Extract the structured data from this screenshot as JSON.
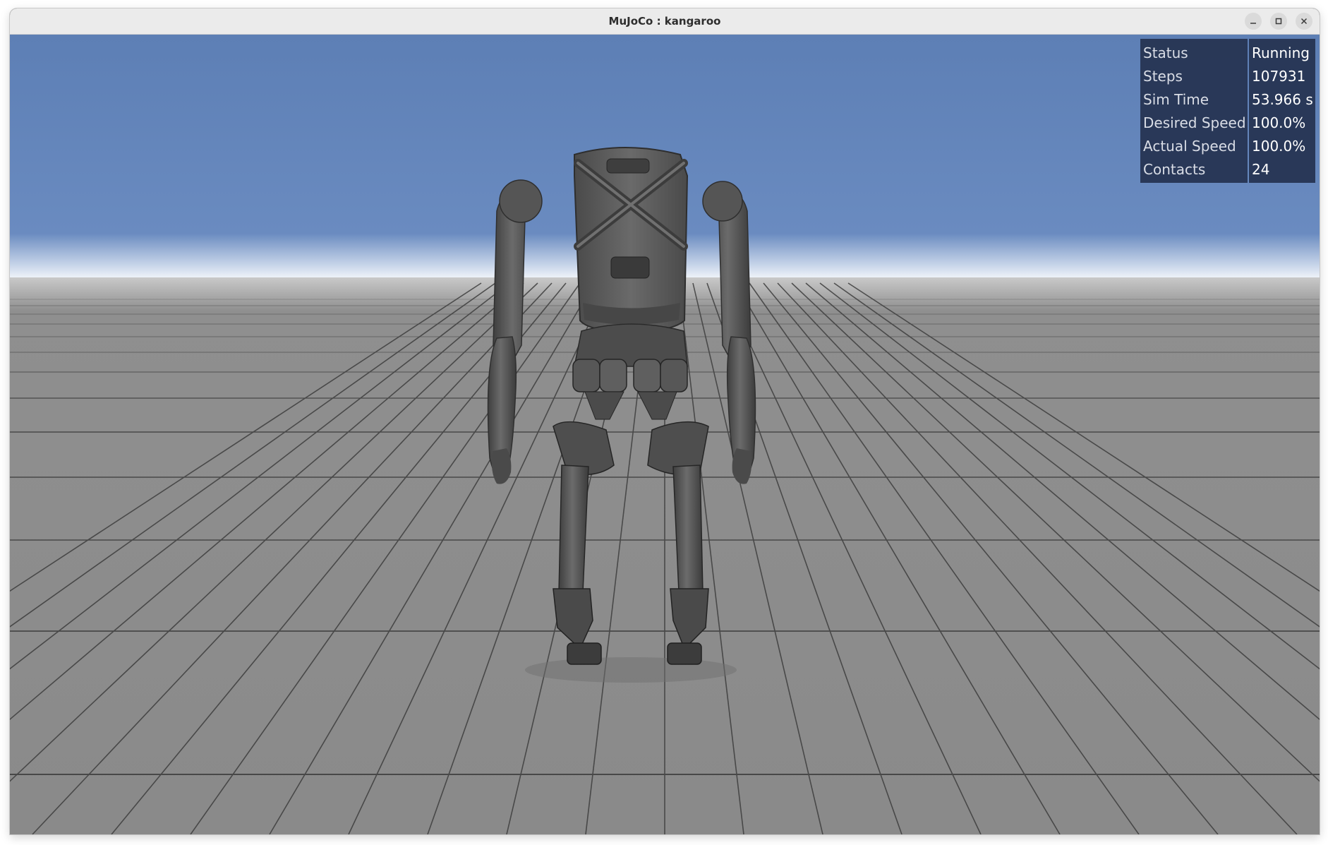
{
  "window": {
    "title": "MuJoCo : kangaroo",
    "controls": [
      {
        "name": "minimize-icon"
      },
      {
        "name": "maximize-icon"
      },
      {
        "name": "close-icon"
      }
    ]
  },
  "info_panel": {
    "rows": [
      {
        "label": "Status",
        "value": "Running"
      },
      {
        "label": "Steps",
        "value": "107931"
      },
      {
        "label": "Sim Time",
        "value": "53.966 s"
      },
      {
        "label": "Desired Speed",
        "value": "100.0%"
      },
      {
        "label": "Actual Speed",
        "value": "100.0%"
      },
      {
        "label": "Contacts",
        "value": "24"
      }
    ]
  },
  "scene": {
    "sky_color": "#5f80b6",
    "floor_color": "#8d8d8d",
    "grid_color": "#3a3a3a",
    "robot_color": "#5a5a5a"
  }
}
